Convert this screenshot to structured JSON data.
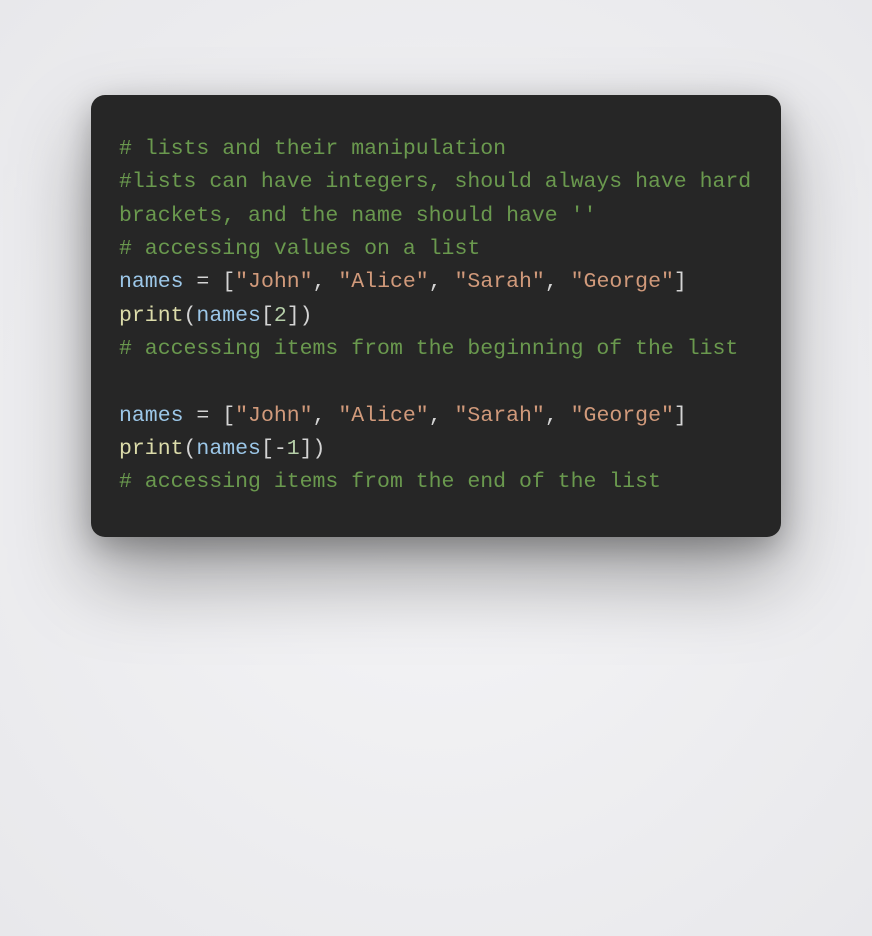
{
  "code": {
    "language": "python",
    "lines": [
      {
        "tokens": [
          {
            "cls": "tok-comment",
            "t": "# lists and their manipulation"
          }
        ]
      },
      {
        "tokens": [
          {
            "cls": "tok-comment",
            "t": "#lists can have integers, should always have hard brackets, and the name should have ''"
          }
        ]
      },
      {
        "tokens": [
          {
            "cls": "tok-comment",
            "t": "# accessing values on a list"
          }
        ]
      },
      {
        "tokens": [
          {
            "cls": "tok-ident",
            "t": "names"
          },
          {
            "cls": "tok-op",
            "t": " = "
          },
          {
            "cls": "tok-punct",
            "t": "["
          },
          {
            "cls": "tok-string",
            "t": "\"John\""
          },
          {
            "cls": "tok-punct",
            "t": ", "
          },
          {
            "cls": "tok-string",
            "t": "\"Alice\""
          },
          {
            "cls": "tok-punct",
            "t": ", "
          },
          {
            "cls": "tok-string",
            "t": "\"Sarah\""
          },
          {
            "cls": "tok-punct",
            "t": ", "
          },
          {
            "cls": "tok-string",
            "t": "\"George\""
          },
          {
            "cls": "tok-punct",
            "t": "]"
          }
        ]
      },
      {
        "tokens": [
          {
            "cls": "tok-func",
            "t": "print"
          },
          {
            "cls": "tok-punct",
            "t": "("
          },
          {
            "cls": "tok-ident",
            "t": "names"
          },
          {
            "cls": "tok-punct",
            "t": "["
          },
          {
            "cls": "tok-number",
            "t": "2"
          },
          {
            "cls": "tok-punct",
            "t": "])"
          }
        ]
      },
      {
        "tokens": [
          {
            "cls": "tok-comment",
            "t": "# accessing items from the beginning of the list"
          }
        ]
      },
      {
        "tokens": [
          {
            "cls": "tok-punct",
            "t": ""
          }
        ]
      },
      {
        "tokens": [
          {
            "cls": "tok-ident",
            "t": "names"
          },
          {
            "cls": "tok-op",
            "t": " = "
          },
          {
            "cls": "tok-punct",
            "t": "["
          },
          {
            "cls": "tok-string",
            "t": "\"John\""
          },
          {
            "cls": "tok-punct",
            "t": ", "
          },
          {
            "cls": "tok-string",
            "t": "\"Alice\""
          },
          {
            "cls": "tok-punct",
            "t": ", "
          },
          {
            "cls": "tok-string",
            "t": "\"Sarah\""
          },
          {
            "cls": "tok-punct",
            "t": ", "
          },
          {
            "cls": "tok-string",
            "t": "\"George\""
          },
          {
            "cls": "tok-punct",
            "t": "]"
          }
        ]
      },
      {
        "tokens": [
          {
            "cls": "tok-func",
            "t": "print"
          },
          {
            "cls": "tok-punct",
            "t": "("
          },
          {
            "cls": "tok-ident",
            "t": "names"
          },
          {
            "cls": "tok-punct",
            "t": "[-"
          },
          {
            "cls": "tok-number",
            "t": "1"
          },
          {
            "cls": "tok-punct",
            "t": "])"
          }
        ]
      },
      {
        "tokens": [
          {
            "cls": "tok-comment",
            "t": "# accessing items from the end of the list"
          }
        ]
      }
    ]
  },
  "colors": {
    "background": "#262626",
    "comment": "#6a994e",
    "identifier": "#9cc7e8",
    "function": "#dcdcaa",
    "punct": "#d4d4d4",
    "string": "#d19a7b",
    "number": "#b5cea8"
  }
}
